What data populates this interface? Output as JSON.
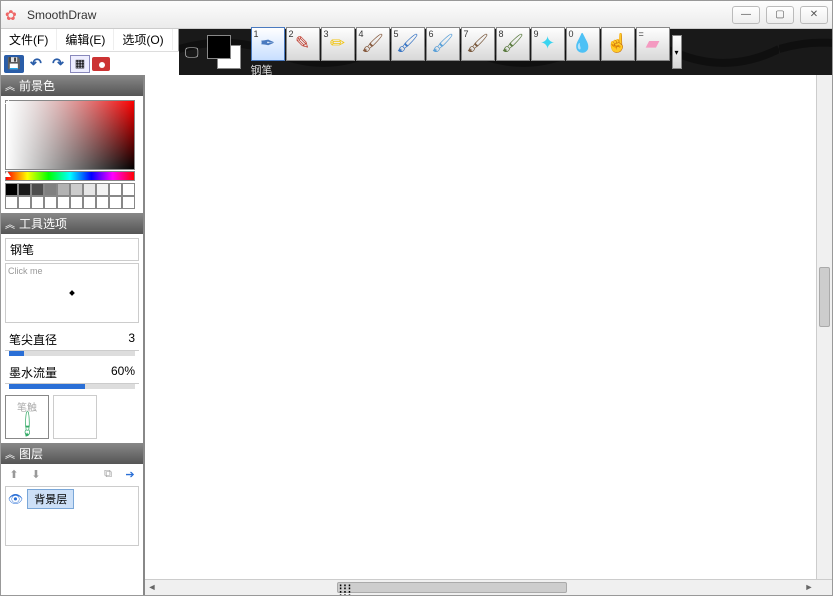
{
  "window": {
    "title": "SmoothDraw"
  },
  "menu": {
    "file": "文件(F)",
    "edit": "编辑(E)",
    "options": "选项(O)"
  },
  "toolbar": {
    "brush_label": "钢笔",
    "tools": [
      {
        "num": "1",
        "glyph": "✒",
        "cls": "bi-pen",
        "name": "pen-tool"
      },
      {
        "num": "2",
        "glyph": "✎",
        "cls": "bi-pencil",
        "name": "pencil-tool"
      },
      {
        "num": "3",
        "glyph": "✏",
        "cls": "bi-marker",
        "name": "marker-tool"
      },
      {
        "num": "4",
        "glyph": "🖌",
        "cls": "bi-brush1",
        "name": "brush-tool-1"
      },
      {
        "num": "5",
        "glyph": "🖌",
        "cls": "bi-brush2",
        "name": "brush-tool-2"
      },
      {
        "num": "6",
        "glyph": "🖌",
        "cls": "bi-brush3",
        "name": "brush-tool-3"
      },
      {
        "num": "7",
        "glyph": "🖌",
        "cls": "bi-brush4",
        "name": "brush-tool-4"
      },
      {
        "num": "8",
        "glyph": "🖌",
        "cls": "bi-brush5",
        "name": "brush-tool-5"
      },
      {
        "num": "9",
        "glyph": "✦",
        "cls": "bi-star",
        "name": "star-tool"
      },
      {
        "num": "0",
        "glyph": "💧",
        "cls": "bi-drop",
        "name": "water-tool"
      },
      {
        "num": "",
        "glyph": "☝",
        "cls": "bi-finger",
        "name": "smudge-tool"
      },
      {
        "num": "=",
        "glyph": "▰",
        "cls": "bi-eraser",
        "name": "eraser-tool"
      }
    ]
  },
  "panels": {
    "foreground": {
      "title": "前景色"
    },
    "tool_options": {
      "title": "工具选项",
      "tool_name": "钢笔",
      "preview_hint": "Click me",
      "tip_diameter_label": "笔尖直径",
      "tip_diameter_value": "3",
      "ink_flow_label": "墨水流量",
      "ink_flow_value": "60%",
      "stroke_label": "笔触"
    },
    "layers": {
      "title": "图层",
      "items": [
        {
          "name": "背景层"
        }
      ]
    }
  },
  "swatches_row1": [
    "#000000",
    "#1a1a1a",
    "#4d4d4d",
    "#808080",
    "#b3b3b3",
    "#cccccc",
    "#e6e6e6",
    "#f2f2f2",
    "#ffffff",
    "#ffffff"
  ],
  "swatches_row2": [
    "#ffffff",
    "#ffffff",
    "#ffffff",
    "#ffffff",
    "#ffffff",
    "#ffffff",
    "#ffffff",
    "#ffffff",
    "#ffffff",
    "#ffffff"
  ],
  "sliders": {
    "tip_fill_pct": 12,
    "ink_fill_pct": 60
  }
}
